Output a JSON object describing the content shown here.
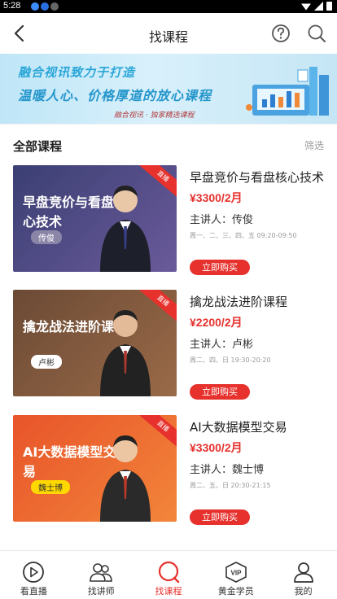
{
  "status_bar": {
    "time": "5:28"
  },
  "header": {
    "title": "找课程"
  },
  "banner": {
    "line1": "融合视讯致力于打造",
    "line2": "温暖人心、价格厚道的放心课程",
    "line3": "融合视讯 · 独家精选课程"
  },
  "section": {
    "title": "全部课程",
    "filter": "筛选"
  },
  "courses": [
    {
      "thumb_text": "早盘竞价与看盘核心技术",
      "thumb_teacher": "传俊",
      "ribbon": "直播",
      "title": "早盘竞价与看盘核心技术",
      "price": "¥3300/2月",
      "teacher": "主讲人：传俊",
      "schedule": "周一、二、三、四、五 09:20-09:50",
      "buy": "立即购买",
      "colors": {
        "bg1": "#3b3f73",
        "bg2": "#6a5a9a",
        "tag_bg": "#ffffff",
        "tag_fg": "#333333"
      }
    },
    {
      "thumb_text": "擒龙战法进阶课程",
      "thumb_teacher": "卢彬",
      "ribbon": "直播",
      "title": "擒龙战法进阶课程",
      "price": "¥2200/2月",
      "teacher": "主讲人：卢彬",
      "schedule": "周二、四、日 19:30-20:20",
      "buy": "立即购买",
      "colors": {
        "bg1": "#6b4a35",
        "bg2": "#9a6a48",
        "tag_bg": "#ffffff",
        "tag_fg": "#333333"
      }
    },
    {
      "thumb_text": "AI大数据模型交易",
      "thumb_teacher": "魏士博",
      "ribbon": "直播",
      "title": "AI大数据模型交易",
      "price": "¥3300/2月",
      "teacher": "主讲人：魏士博",
      "schedule": "周二、五、日 20:30-21:15",
      "buy": "立即购买",
      "colors": {
        "bg1": "#e8542a",
        "bg2": "#f2853a",
        "tag_bg": "#ffd800",
        "tag_fg": "#333333"
      }
    }
  ],
  "nav": [
    {
      "label": "看直播",
      "icon": "play-circle-icon"
    },
    {
      "label": "找讲师",
      "icon": "teachers-icon"
    },
    {
      "label": "找课程",
      "icon": "course-icon",
      "active": true
    },
    {
      "label": "黄金学员",
      "icon": "vip-icon"
    },
    {
      "label": "我的",
      "icon": "user-icon"
    }
  ],
  "accent_color": "#e6312d"
}
